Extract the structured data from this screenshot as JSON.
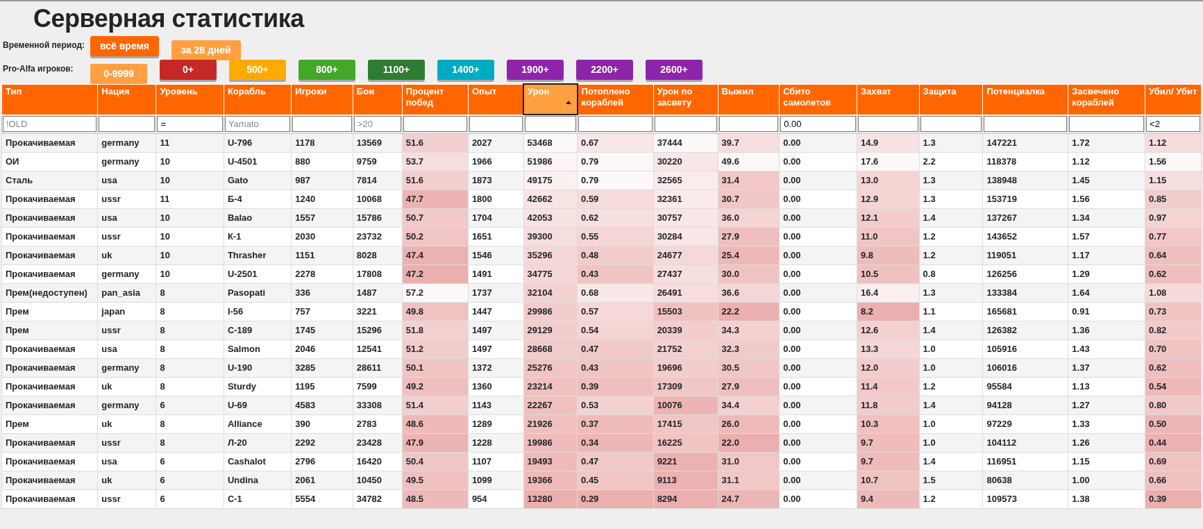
{
  "title": "Серверная статистика",
  "period": {
    "label": "Временной период:",
    "buttons": [
      {
        "label": "всё время",
        "color": "#ff6600",
        "selected": false
      },
      {
        "label": "за 28 дней",
        "color": "#ffa040",
        "selected": true
      }
    ]
  },
  "players": {
    "label": "Pro-Alfa игроков:",
    "buttons": [
      {
        "label": "0-9999",
        "color": "#ffa040",
        "selected": true
      },
      {
        "label": "0+",
        "color": "#c62828",
        "selected": false
      },
      {
        "label": "500+",
        "color": "#ffaa00",
        "selected": false
      },
      {
        "label": "800+",
        "color": "#43a829",
        "selected": false
      },
      {
        "label": "1100+",
        "color": "#2e7d32",
        "selected": false
      },
      {
        "label": "1400+",
        "color": "#00acc1",
        "selected": false
      },
      {
        "label": "1900+",
        "color": "#8e24aa",
        "selected": false
      },
      {
        "label": "2200+",
        "color": "#8e24aa",
        "selected": false
      },
      {
        "label": "2600+",
        "color": "#8e24aa",
        "selected": false
      }
    ]
  },
  "table": {
    "columns": [
      {
        "label": "Тип",
        "sorted": false,
        "heat": false,
        "filter": {
          "placeholder": "!OLD"
        }
      },
      {
        "label": "Нация",
        "sorted": false,
        "heat": false
      },
      {
        "label": "Уровень",
        "sorted": false,
        "heat": false,
        "filter": {
          "value": "="
        }
      },
      {
        "label": "Корабль",
        "sorted": false,
        "heat": false,
        "filter": {
          "placeholder": "Yamato"
        }
      },
      {
        "label": "Игроки",
        "sorted": false,
        "heat": false
      },
      {
        "label": "Бои",
        "sorted": false,
        "heat": false,
        "filter": {
          "placeholder": ">20"
        }
      },
      {
        "label": "Процент побед",
        "sorted": false,
        "heat": true
      },
      {
        "label": "Опыт",
        "sorted": false,
        "heat": false
      },
      {
        "label": "Урон",
        "sorted": true,
        "heat": true
      },
      {
        "label": "Потоплено кораблей",
        "sorted": false,
        "heat": true
      },
      {
        "label": "Урон по засвету",
        "sorted": false,
        "heat": true
      },
      {
        "label": "Выжил",
        "sorted": false,
        "heat": true
      },
      {
        "label": "Сбито самолетов",
        "sorted": false,
        "heat": false,
        "filter": {
          "value": "0.00"
        }
      },
      {
        "label": "Захват",
        "sorted": false,
        "heat": true
      },
      {
        "label": "Защита",
        "sorted": false,
        "heat": false
      },
      {
        "label": "Потенциалка",
        "sorted": false,
        "heat": false
      },
      {
        "label": "Засвечено кораблей",
        "sorted": false,
        "heat": false
      },
      {
        "label": "Убил/ Убит",
        "sorted": false,
        "heat": true,
        "filter": {
          "value": "<2"
        }
      }
    ],
    "rows": [
      [
        "Прокачиваемая",
        "germany",
        "11",
        "U-796",
        "1178",
        "13569",
        "51.6",
        "2027",
        "53468",
        "0.67",
        "37444",
        "39.7",
        "0.00",
        "14.9",
        "1.3",
        "147221",
        "1.72",
        "1.12"
      ],
      [
        "ОИ",
        "germany",
        "10",
        "U-4501",
        "880",
        "9759",
        "53.7",
        "1966",
        "51986",
        "0.79",
        "30220",
        "49.6",
        "0.00",
        "17.6",
        "2.2",
        "118378",
        "1.12",
        "1.56"
      ],
      [
        "Сталь",
        "usa",
        "10",
        "Gato",
        "987",
        "7814",
        "51.6",
        "1873",
        "49175",
        "0.79",
        "32565",
        "31.4",
        "0.00",
        "13.0",
        "1.3",
        "138948",
        "1.45",
        "1.15"
      ],
      [
        "Прокачиваемая",
        "ussr",
        "11",
        "Б-4",
        "1240",
        "10068",
        "47.7",
        "1800",
        "42662",
        "0.59",
        "32361",
        "30.7",
        "0.00",
        "12.9",
        "1.3",
        "153719",
        "1.56",
        "0.85"
      ],
      [
        "Прокачиваемая",
        "usa",
        "10",
        "Balao",
        "1557",
        "15786",
        "50.7",
        "1704",
        "42053",
        "0.62",
        "30757",
        "36.0",
        "0.00",
        "12.1",
        "1.4",
        "137267",
        "1.34",
        "0.97"
      ],
      [
        "Прокачиваемая",
        "ussr",
        "10",
        "К-1",
        "2030",
        "23732",
        "50.2",
        "1651",
        "39300",
        "0.55",
        "30284",
        "27.9",
        "0.00",
        "11.0",
        "1.2",
        "143652",
        "1.57",
        "0.77"
      ],
      [
        "Прокачиваемая",
        "uk",
        "10",
        "Thrasher",
        "1151",
        "8028",
        "47.4",
        "1546",
        "35296",
        "0.48",
        "24677",
        "25.4",
        "0.00",
        "9.8",
        "1.2",
        "119051",
        "1.17",
        "0.64"
      ],
      [
        "Прокачиваемая",
        "germany",
        "10",
        "U-2501",
        "2278",
        "17808",
        "47.2",
        "1491",
        "34775",
        "0.43",
        "27437",
        "30.0",
        "0.00",
        "10.5",
        "0.8",
        "126256",
        "1.29",
        "0.62"
      ],
      [
        "Прем(недоступен)",
        "pan_asia",
        "8",
        "Pasopati",
        "336",
        "1487",
        "57.2",
        "1737",
        "32104",
        "0.68",
        "26491",
        "36.6",
        "0.00",
        "16.4",
        "1.3",
        "133384",
        "1.64",
        "1.08"
      ],
      [
        "Прем",
        "japan",
        "8",
        "I-56",
        "757",
        "3221",
        "49.8",
        "1447",
        "29986",
        "0.57",
        "15503",
        "22.2",
        "0.00",
        "8.2",
        "1.1",
        "165681",
        "0.91",
        "0.73"
      ],
      [
        "Прем",
        "ussr",
        "8",
        "С-189",
        "1745",
        "15296",
        "51.8",
        "1497",
        "29129",
        "0.54",
        "20339",
        "34.3",
        "0.00",
        "12.6",
        "1.4",
        "126382",
        "1.36",
        "0.82"
      ],
      [
        "Прокачиваемая",
        "usa",
        "8",
        "Salmon",
        "2046",
        "12541",
        "51.2",
        "1497",
        "28668",
        "0.47",
        "21752",
        "32.3",
        "0.00",
        "13.3",
        "1.0",
        "105916",
        "1.43",
        "0.70"
      ],
      [
        "Прокачиваемая",
        "germany",
        "8",
        "U-190",
        "3285",
        "28611",
        "50.1",
        "1372",
        "25276",
        "0.43",
        "19696",
        "30.5",
        "0.00",
        "12.0",
        "1.0",
        "106016",
        "1.37",
        "0.62"
      ],
      [
        "Прокачиваемая",
        "uk",
        "8",
        "Sturdy",
        "1195",
        "7599",
        "49.2",
        "1360",
        "23214",
        "0.39",
        "17309",
        "27.9",
        "0.00",
        "11.4",
        "1.2",
        "95584",
        "1.13",
        "0.54"
      ],
      [
        "Прокачиваемая",
        "germany",
        "6",
        "U-69",
        "4583",
        "33308",
        "51.4",
        "1143",
        "22267",
        "0.53",
        "10076",
        "34.4",
        "0.00",
        "11.8",
        "1.4",
        "94128",
        "1.27",
        "0.80"
      ],
      [
        "Прем",
        "uk",
        "8",
        "Alliance",
        "390",
        "2783",
        "48.6",
        "1289",
        "21926",
        "0.37",
        "17415",
        "26.0",
        "0.00",
        "10.3",
        "1.0",
        "97229",
        "1.33",
        "0.50"
      ],
      [
        "Прокачиваемая",
        "ussr",
        "8",
        "Л-20",
        "2292",
        "23428",
        "47.9",
        "1228",
        "19986",
        "0.34",
        "16225",
        "22.0",
        "0.00",
        "9.7",
        "1.0",
        "104112",
        "1.26",
        "0.44"
      ],
      [
        "Прокачиваемая",
        "usa",
        "6",
        "Cashalot",
        "2796",
        "16420",
        "50.4",
        "1107",
        "19493",
        "0.47",
        "9221",
        "31.0",
        "0.00",
        "9.7",
        "1.4",
        "116951",
        "1.15",
        "0.69"
      ],
      [
        "Прокачиваемая",
        "uk",
        "6",
        "Undina",
        "2061",
        "10450",
        "49.5",
        "1099",
        "19366",
        "0.45",
        "9113",
        "31.1",
        "0.00",
        "10.7",
        "1.5",
        "80638",
        "1.00",
        "0.66"
      ],
      [
        "Прокачиваемая",
        "ussr",
        "6",
        "С-1",
        "5554",
        "34782",
        "48.5",
        "954",
        "13280",
        "0.29",
        "8294",
        "24.7",
        "0.00",
        "9.4",
        "1.2",
        "109573",
        "1.38",
        "0.39"
      ]
    ]
  }
}
